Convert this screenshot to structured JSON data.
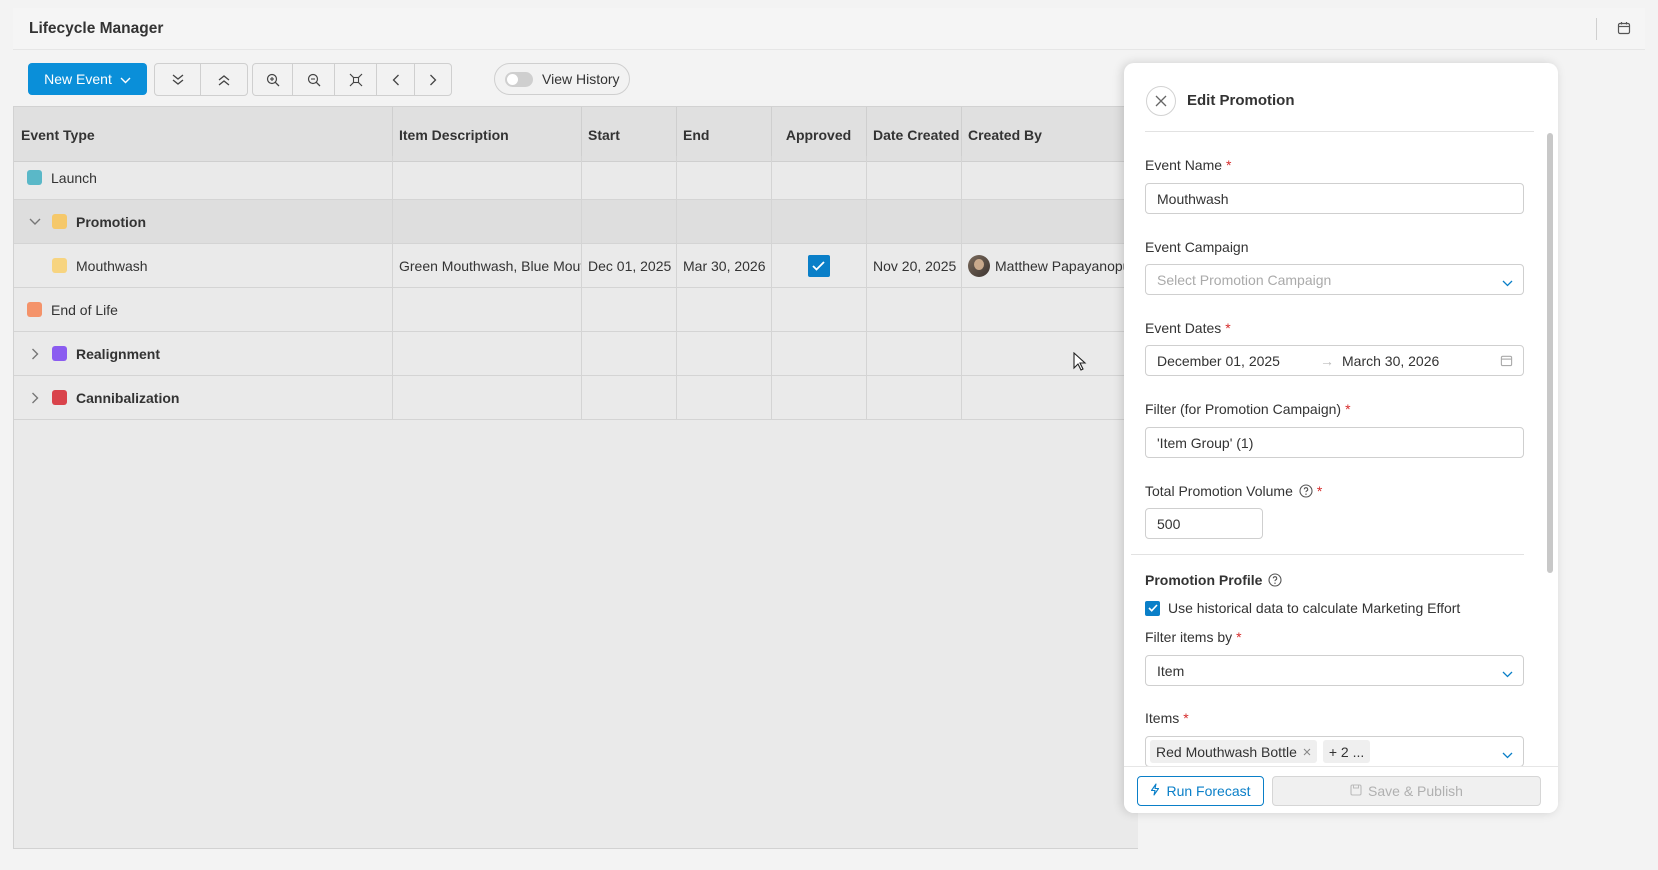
{
  "app": {
    "title": "Lifecycle Manager",
    "calendar_icon": "calendar-icon"
  },
  "toolbar": {
    "new_event_label": "New Event",
    "view_history_label": "View History",
    "view_history_on": false,
    "icons": [
      "collapse-all-icon",
      "expand-all-icon",
      "zoom-in-icon",
      "zoom-out-icon",
      "fit-icon",
      "prev-icon",
      "next-icon"
    ]
  },
  "grid": {
    "columns": [
      "Event Type",
      "Item Description",
      "Start",
      "End",
      "Approved",
      "Date Created",
      "Created By"
    ],
    "rows": [
      {
        "type": "Launch",
        "color": "#5ab8c8",
        "bold": false,
        "expander": "none"
      },
      {
        "type": "Promotion",
        "color": "#f5c86a",
        "bold": true,
        "expander": "expanded"
      },
      {
        "type": "Mouthwash",
        "color": "#f7d480",
        "bold": false,
        "expander": "child",
        "item_description": "Green Mouthwash, Blue Mouthwash",
        "start": "Dec 01, 2025",
        "end": "Mar 30, 2026",
        "approved": true,
        "date_created": "Nov 20, 2025",
        "created_by": "Matthew Papayanopulos"
      },
      {
        "type": "End of Life",
        "color": "#f4936a",
        "bold": false,
        "expander": "none"
      },
      {
        "type": "Realignment",
        "color": "#8b5cf0",
        "bold": true,
        "expander": "collapsed"
      },
      {
        "type": "Cannibalization",
        "color": "#d9434b",
        "bold": true,
        "expander": "collapsed"
      }
    ]
  },
  "panel": {
    "title": "Edit Promotion",
    "event_name": {
      "label": "Event Name",
      "value": "Mouthwash"
    },
    "event_campaign": {
      "label": "Event Campaign",
      "placeholder": "Select Promotion Campaign"
    },
    "event_dates": {
      "label": "Event Dates",
      "start": "December 01, 2025",
      "arrow": "→",
      "end": "March 30, 2026"
    },
    "filter": {
      "label": "Filter (for Promotion Campaign)",
      "value": "'Item Group' (1)"
    },
    "volume": {
      "label": "Total Promotion Volume",
      "value": "500"
    },
    "profile": {
      "title": "Promotion Profile",
      "use_historical_label": "Use historical data to calculate Marketing Effort",
      "use_historical_checked": true
    },
    "filter_items_by": {
      "label": "Filter items by",
      "value": "Item"
    },
    "items": {
      "label": "Items",
      "tag": "Red Mouthwash Bottle",
      "more": "+ 2 ..."
    },
    "run_forecast_label": "Run Forecast",
    "save_publish_label": "Save & Publish"
  }
}
